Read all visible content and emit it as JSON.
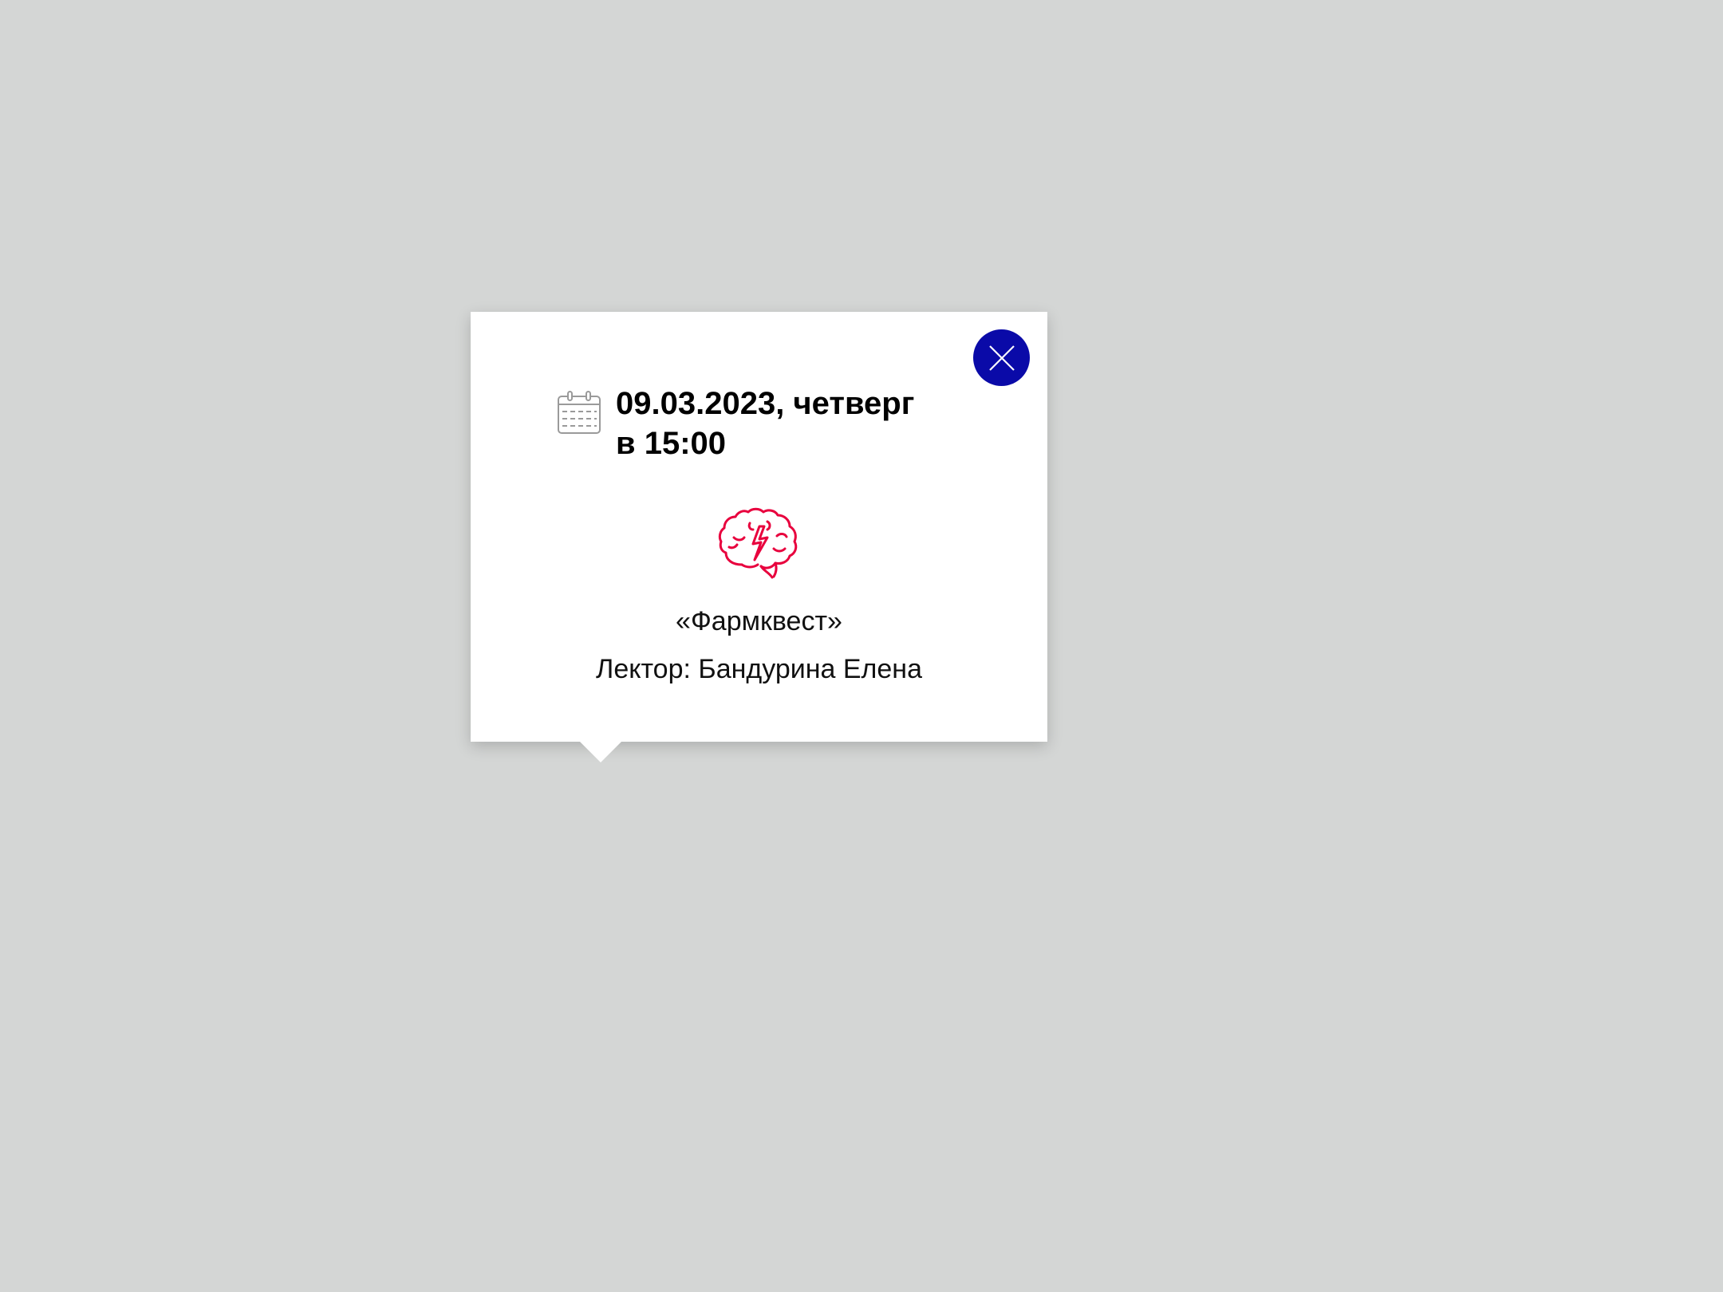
{
  "popup": {
    "date_line": "09.03.2023, четверг",
    "time_line": "в 15:00",
    "title": "«Фармквест»",
    "lecturer": "Лектор: Бандурина Елена",
    "icons": {
      "close": "close-icon",
      "calendar": "calendar-icon",
      "category": "brain-lightning-icon"
    }
  },
  "colors": {
    "background": "#d4d6d5",
    "close_button": "#0a0aa8",
    "brain_icon": "#e8003d",
    "calendar_icon": "#9a9a9a"
  }
}
